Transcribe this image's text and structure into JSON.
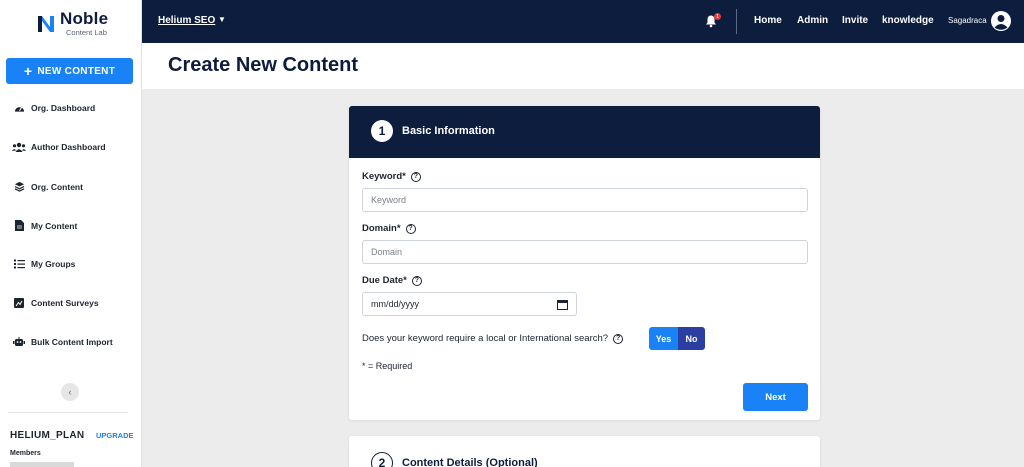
{
  "brand": {
    "title": "Noble",
    "subtitle": "Content Lab"
  },
  "sidebar": {
    "new_content_label": "NEW CONTENT",
    "items": [
      {
        "label": "Org. Dashboard",
        "icon": "gauge-icon"
      },
      {
        "label": "Author Dashboard",
        "icon": "users-icon"
      },
      {
        "label": "Org. Content",
        "icon": "layers-icon"
      },
      {
        "label": "My Content",
        "icon": "file-icon"
      },
      {
        "label": "My Groups",
        "icon": "list-icon"
      },
      {
        "label": "Content Surveys",
        "icon": "chart-icon"
      },
      {
        "label": "Bulk Content Import",
        "icon": "robot-icon"
      }
    ],
    "plan": {
      "name": "HELIUM_PLAN",
      "upgrade_label": "UPGRADE",
      "members_label": "Members",
      "members_count": ""
    }
  },
  "topbar": {
    "org_name": "Helium SEO",
    "notification_count": "1",
    "links": [
      "Home",
      "Admin",
      "Invite",
      "knowledge"
    ],
    "user_name": "Sagadraca"
  },
  "page": {
    "title": "Create New Content"
  },
  "step1": {
    "number": "1",
    "title": "Basic Information",
    "keyword_label": "Keyword*",
    "keyword_placeholder": "Keyword",
    "domain_label": "Domain*",
    "domain_placeholder": "Domain",
    "due_date_label": "Due Date*",
    "due_date_placeholder": "mm/dd/yyyy",
    "question": "Does your keyword require a local or International search?",
    "yes_label": "Yes",
    "no_label": "No",
    "required_note": "* = Required",
    "next_label": "Next"
  },
  "step2": {
    "number": "2",
    "title": "Content Details (Optional)"
  },
  "colors": {
    "navy": "#0c1d3d",
    "accent": "#1a82f7",
    "toggle_dark": "#2b3fa3"
  }
}
